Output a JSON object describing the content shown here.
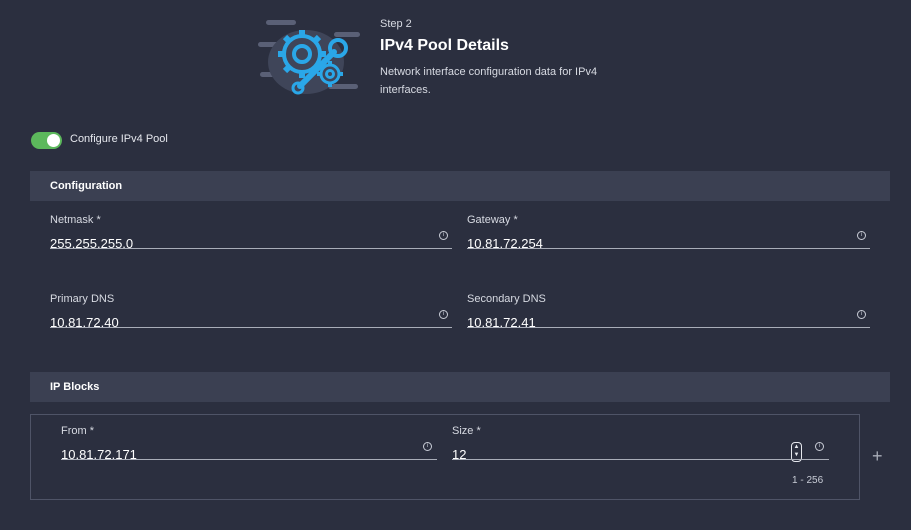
{
  "header": {
    "step_label": "Step 2",
    "title": "IPv4 Pool Details",
    "description": "Network interface configuration data for IPv4 interfaces."
  },
  "toggle": {
    "label": "Configure IPv4 Pool",
    "on": true
  },
  "sections": {
    "configuration": "Configuration",
    "ip_blocks": "IP Blocks"
  },
  "configuration": {
    "netmask": {
      "label": "Netmask *",
      "value": "255.255.255.0"
    },
    "gateway": {
      "label": "Gateway *",
      "value": "10.81.72.254"
    },
    "primary_dns": {
      "label": "Primary DNS",
      "value": "10.81.72.40"
    },
    "secondary_dns": {
      "label": "Secondary DNS",
      "value": "10.81.72.41"
    }
  },
  "ip_blocks": {
    "from": {
      "label": "From *",
      "value": "10.81.72.171"
    },
    "size": {
      "label": "Size *",
      "value": "12",
      "range_hint": "1 - 256"
    }
  },
  "icons": {
    "info": "info-icon",
    "add": "plus-icon",
    "stepper": "stepper-icon",
    "graphic": "gear-wrench-icon"
  },
  "colors": {
    "background": "#2b2f3f",
    "section_bar": "#3b4052",
    "toggle_on": "#5cb85c",
    "accent_blue": "#2aa7e8"
  }
}
